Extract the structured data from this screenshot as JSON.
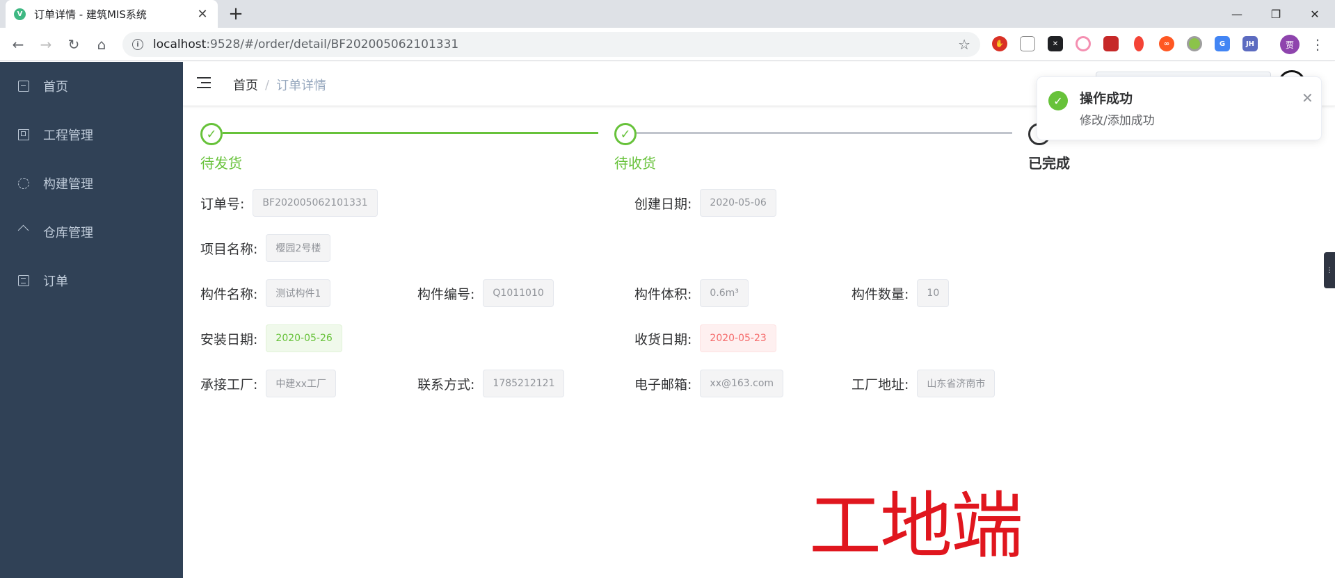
{
  "browser": {
    "tab_title": "订单详情 - 建筑MIS系统",
    "tab_favicon": "V",
    "url_host": "localhost",
    "url_rest": ":9528/#/order/detail/BF202005062101331",
    "profile_initial": "贾",
    "extensions": [
      "ext-adblock-icon",
      "ext-qr-icon",
      "ext-x-icon",
      "ext-ring-icon",
      "ext-douban-icon",
      "ext-drop-icon",
      "ext-loop-icon",
      "ext-circle-icon",
      "ext-translate-icon",
      "ext-jh-icon"
    ],
    "ext_jh_label": "JH"
  },
  "sidebar": {
    "items": [
      {
        "label": "首页",
        "icon": "dashboard-icon"
      },
      {
        "label": "工程管理",
        "icon": "project-icon"
      },
      {
        "label": "构建管理",
        "icon": "component-icon"
      },
      {
        "label": "仓库管理",
        "icon": "warehouse-icon"
      },
      {
        "label": "订单",
        "icon": "order-icon"
      }
    ]
  },
  "header": {
    "breadcrumb": {
      "home": "首页",
      "separator": "/",
      "current": "订单详情"
    }
  },
  "steps": [
    {
      "title": "待发货",
      "status": "finished"
    },
    {
      "title": "待收货",
      "status": "finished"
    },
    {
      "title": "已完成",
      "status": "process"
    }
  ],
  "form": {
    "order_no": {
      "label": "订单号:",
      "value": "BF202005062101331"
    },
    "create_date": {
      "label": "创建日期:",
      "value": "2020-05-06"
    },
    "project_name": {
      "label": "项目名称:",
      "value": "樱园2号楼"
    },
    "component_name": {
      "label": "构件名称:",
      "value": "测试构件1"
    },
    "component_no": {
      "label": "构件编号:",
      "value": "Q1011010"
    },
    "component_volume": {
      "label": "构件体积:",
      "value": "0.6m³"
    },
    "component_qty": {
      "label": "构件数量:",
      "value": "10"
    },
    "install_date": {
      "label": "安装日期:",
      "value": "2020-05-26"
    },
    "receive_date": {
      "label": "收货日期:",
      "value": "2020-05-23"
    },
    "factory": {
      "label": "承接工厂:",
      "value": "中建xx工厂"
    },
    "contact": {
      "label": "联系方式:",
      "value": "1785212121"
    },
    "email": {
      "label": "电子邮箱:",
      "value": "xx@163.com"
    },
    "factory_addr": {
      "label": "工厂地址:",
      "value": "山东省济南市"
    }
  },
  "watermark": "工地端",
  "notification": {
    "title": "操作成功",
    "message": "修改/添加成功"
  },
  "colors": {
    "sidebar_bg": "#304156",
    "success": "#67c23a",
    "danger": "#f56c6c",
    "watermark": "#e0161e"
  }
}
